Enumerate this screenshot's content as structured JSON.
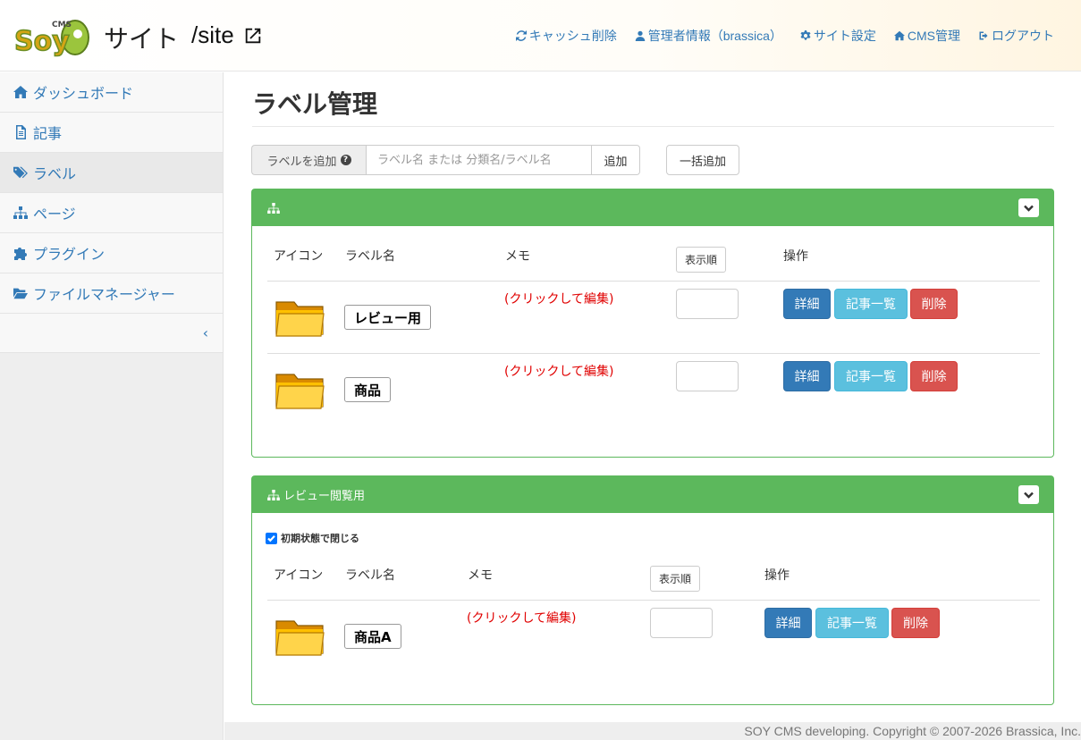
{
  "header": {
    "logo_text": "Soy",
    "logo_badge": "CMS",
    "site_title": "サイト",
    "site_path": "/site",
    "nav": [
      {
        "label": "キャッシュ削除",
        "icon": "refresh-icon"
      },
      {
        "label": "管理者情報（brassica）",
        "icon": "user-icon"
      },
      {
        "label": "サイト設定",
        "icon": "gear-icon"
      },
      {
        "label": "CMS管理",
        "icon": "home-icon"
      },
      {
        "label": "ログアウト",
        "icon": "logout-icon"
      }
    ]
  },
  "sidebar": {
    "items": [
      {
        "label": "ダッシュボード",
        "icon": "home-icon"
      },
      {
        "label": "記事",
        "icon": "file-icon"
      },
      {
        "label": "ラベル",
        "icon": "tags-icon",
        "active": true
      },
      {
        "label": "ページ",
        "icon": "sitemap-icon"
      },
      {
        "label": "プラグイン",
        "icon": "puzzle-icon"
      },
      {
        "label": "ファイルマネージャー",
        "icon": "folder-open-icon"
      }
    ],
    "collapse_symbol": "‹"
  },
  "main": {
    "title": "ラベル管理",
    "add_bar": {
      "addon_label": "ラベルを追加",
      "help_icon": "question-circle-icon",
      "input_placeholder": "ラベル名 または 分類名/ラベル名",
      "input_value": "",
      "add_button": "追加",
      "bulk_button": "一括追加"
    },
    "columns": {
      "icon": "アイコン",
      "name": "ラベル名",
      "memo": "メモ",
      "order": "表示順",
      "actions": "操作"
    },
    "buttons": {
      "detail": "詳細",
      "entries": "記事一覧",
      "delete": "削除"
    },
    "memo_placeholder": "(クリックして編集)",
    "groups": [
      {
        "title": "",
        "labels": [
          {
            "name": "レビュー用",
            "memo": "(クリックして編集)",
            "order": ""
          },
          {
            "name": "商品",
            "memo": "(クリックして編集)",
            "order": ""
          }
        ]
      },
      {
        "title": "レビュー閲覧用",
        "checkbox_label": "初期状態で閉じる",
        "checkbox_checked": true,
        "labels": [
          {
            "name": "商品A",
            "memo": "(クリックして編集)",
            "order": ""
          }
        ]
      }
    ]
  },
  "footer": {
    "text": "SOY CMS developing. Copyright © 2007-2026 Brassica, Inc."
  },
  "colors": {
    "link": "#337ab7",
    "panel_green": "#5cb85c",
    "btn_primary": "#337ab7",
    "btn_info": "#5bc0de",
    "btn_danger": "#d9534f",
    "memo_red": "#e00000"
  }
}
